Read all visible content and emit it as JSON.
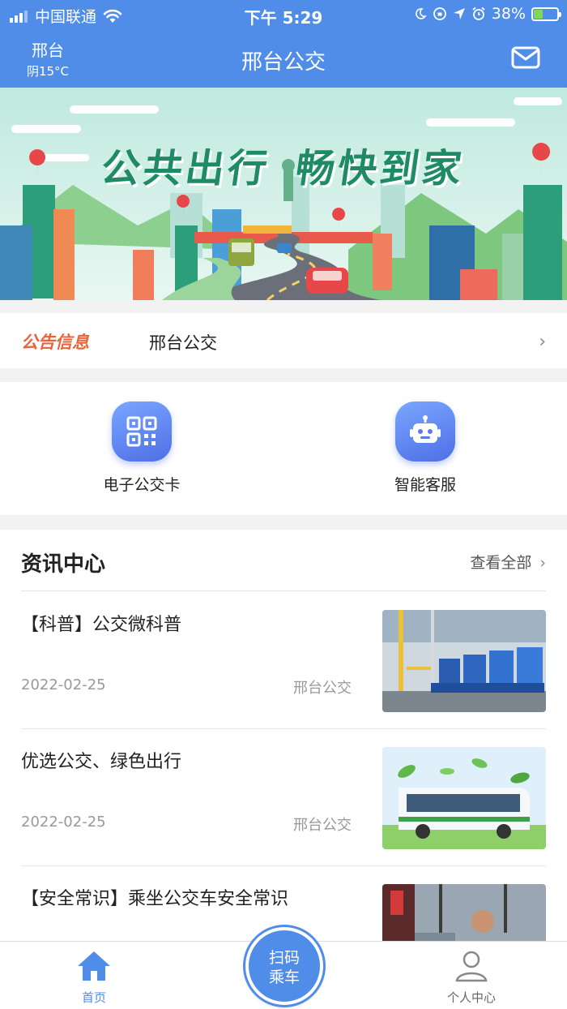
{
  "status_bar": {
    "carrier": "中国联通",
    "time": "下午 5:29",
    "battery": "38%",
    "icons": [
      "signal-icon",
      "wifi-icon",
      "moon-icon",
      "orientation-lock-icon",
      "location-icon",
      "alarm-icon",
      "battery-icon"
    ]
  },
  "nav": {
    "city": "邢台",
    "weather": "阴15°C",
    "title": "邢台公交",
    "mail_icon": "mail-icon"
  },
  "banner": {
    "slogan_1": "公共出行",
    "slogan_2": "畅快到家"
  },
  "notice": {
    "label": "公告信息",
    "text": "邢台公交"
  },
  "actions": [
    {
      "label": "电子公交卡",
      "icon": "qr-card-icon"
    },
    {
      "label": "智能客服",
      "icon": "robot-icon"
    }
  ],
  "news": {
    "title": "资讯中心",
    "more": "查看全部",
    "items": [
      {
        "title": "【科普】公交微科普",
        "date": "2022-02-25",
        "source": "邢台公交",
        "thumb": "bus-seats-photo"
      },
      {
        "title": "优选公交、绿色出行",
        "date": "2022-02-25",
        "source": "邢台公交",
        "thumb": "green-bus-photo"
      },
      {
        "title": "【安全常识】乘坐公交车安全常识",
        "date": "",
        "source": "",
        "thumb": "bus-driver-photo"
      }
    ]
  },
  "tabbar": {
    "home": "首页",
    "scan_line1": "扫码",
    "scan_line2": "乘车",
    "profile": "个人中心"
  },
  "colors": {
    "primary": "#4f8de9",
    "notice_label": "#e8643a",
    "banner_text": "#1f8a66",
    "muted_text": "#999999"
  }
}
